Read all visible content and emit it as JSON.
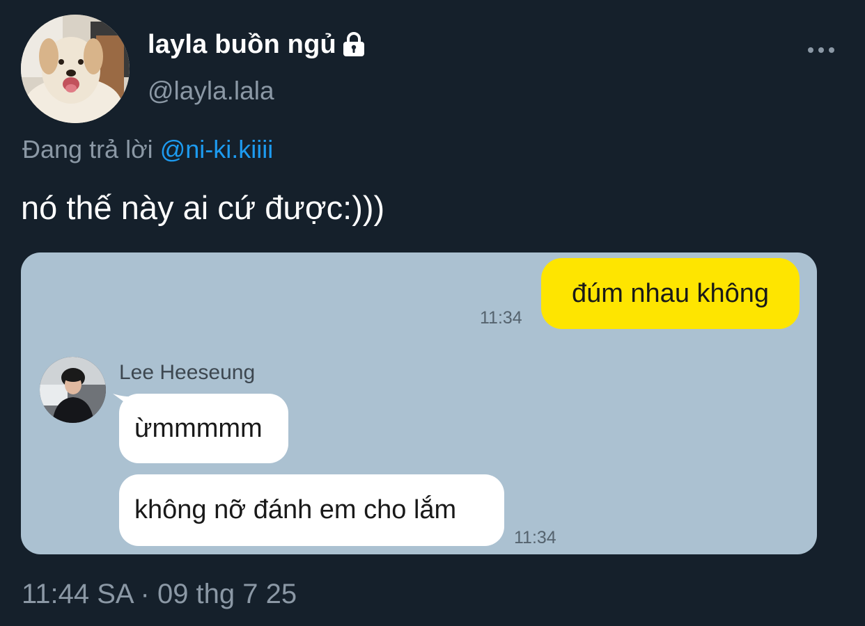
{
  "author": {
    "display_name": "layla buồn ngủ",
    "handle": "@layla.lala",
    "protected_icon": "lock-icon",
    "avatar_icon": "dog-avatar"
  },
  "menu": {
    "icon": "more-horizontal-icon"
  },
  "reply": {
    "prefix": "Đang trả lời",
    "mention": "@ni-ki.kiiii"
  },
  "tweet": {
    "text": "nó thế này ai cứ được:)))"
  },
  "media": {
    "outgoing_message": "đúm nhau không",
    "outgoing_time": "11:34",
    "friend_name": "Lee Heeseung",
    "incoming_messages": [
      "ừmmmmm",
      "không nỡ đánh em cho lắm"
    ],
    "incoming_time": "11:34",
    "colors": {
      "chat_background": "#abc1d1",
      "outgoing_bubble": "#fee500",
      "incoming_bubble": "#ffffff"
    }
  },
  "footer": {
    "timestamp": "11:44 SA · 09 thg 7 25"
  },
  "colors": {
    "background": "#15202b",
    "mention": "#1d9bf0",
    "secondary_text": "#8b98a5"
  }
}
